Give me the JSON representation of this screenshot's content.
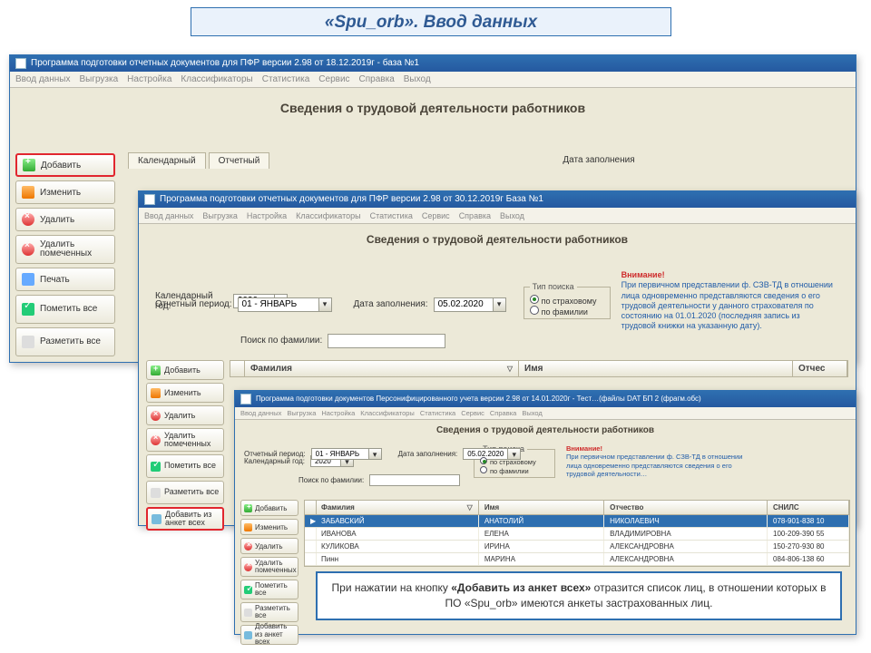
{
  "slide_title": "«Spu_orb». Ввод данных",
  "win1": {
    "title": "Программа подготовки отчетных документов для ПФР версии 2.98 от 18.12.2019г - база №1",
    "menu": [
      "Ввод данных",
      "Выгрузка",
      "Настройка",
      "Классификаторы",
      "Статистика",
      "Сервис",
      "Справка",
      "Выход"
    ],
    "heading": "Сведения о трудовой деятельности работников",
    "sidebar": [
      "Добавить",
      "Изменить",
      "Удалить",
      "Удалить помеченных",
      "Печать",
      "Пометить все",
      "Разметить все"
    ],
    "tabs": [
      "Календарный",
      "Отчетный"
    ],
    "date_label": "Дата заполнения"
  },
  "win2": {
    "title": "Программа подготовки отчетных документов для ПФР версии 2.98 от 30.12.2019г   База №1",
    "menu": [
      "Ввод данных",
      "Выгрузка",
      "Настройка",
      "Классификаторы",
      "Статистика",
      "Сервис",
      "Справка",
      "Выход"
    ],
    "heading": "Сведения о трудовой деятельности работников",
    "year_label": "Календарный год:",
    "year_value": "2020",
    "period_label": "Отчетный период:",
    "period_value": "01 - ЯНВАРЬ",
    "fill_date_label": "Дата заполнения:",
    "fill_date_value": "05.02.2020",
    "search_group": "Тип поиска",
    "radio1": "по страховому",
    "radio2": "по фамилии",
    "notice_title": "Внимание!",
    "notice_body": "При первичном представлении ф. СЗВ-ТД в отношении лица одновременно представляются сведения о его трудовой деятельности у данного страхователя по состоянию на 01.01.2020 (последняя запись из трудовой книжки на указанную дату).",
    "search_label": "Поиск по фамилии:",
    "columns": [
      "Фамилия",
      "Имя",
      "Отчес"
    ],
    "sidebar": [
      "Добавить",
      "Изменить",
      "Удалить",
      "Удалить помеченных",
      "Пометить все",
      "Разметить все",
      "Добавить из анкет всех"
    ]
  },
  "win3": {
    "title": "Программа подготовки документов Персонифицированного учета версии 2.98 от 14.01.2020г - Тест…(файлы DAT БП 2 (фрагм.обс)",
    "menu": [
      "Ввод данных",
      "Выгрузка",
      "Настройка",
      "Классификаторы",
      "Статистика",
      "Сервис",
      "Справка",
      "Выход"
    ],
    "heading": "Сведения о трудовой деятельности работников",
    "year_label": "Календарный год:",
    "year_value": "2020",
    "period_label": "Отчетный период:",
    "period_value": "01 - ЯНВАРЬ",
    "fill_date_label": "Дата заполнения:",
    "fill_date_value": "05.02.2020",
    "search_group": "Тип поиска",
    "radio1": "по страховому",
    "radio2": "по фамилии",
    "search_label": "Поиск по фамилии:",
    "notice_title": "Внимание!",
    "notice_body": "При первичном представлении ф. СЗВ-ТД в отношении лица одновременно представляются сведения о его трудовой деятельности…",
    "columns": [
      "Фамилия",
      "Имя",
      "Отчество",
      "СНИЛС"
    ],
    "sidebar": [
      "Добавить",
      "Изменить",
      "Удалить",
      "Удалить помеченных",
      "Пометить все",
      "Разметить все",
      "Добавить из анкет всех"
    ],
    "rows": [
      {
        "f": "ЗАБАВСКИЙ",
        "i": "АНАТОЛИЙ",
        "o": "НИКОЛАЕВИЧ",
        "s": "078-901-838 10"
      },
      {
        "f": "ИВАНОВА",
        "i": "ЕЛЕНА",
        "o": "ВЛАДИМИРОВНА",
        "s": "100-209-390 55"
      },
      {
        "f": "КУЛИКОВА",
        "i": "ИРИНА",
        "o": "АЛЕКСАНДРОВНА",
        "s": "150-270-930 80"
      },
      {
        "f": "Пинн",
        "i": "МАРИНА",
        "o": "АЛЕКСАНДРОВНА",
        "s": "084-806-138 60"
      }
    ]
  },
  "callout": "При нажатии на кнопку «Добавить из анкет всех» отразится список лиц, в отношении которых в ПО «Spu_orb» имеются анкеты застрахованных лиц.",
  "chart_data": {
    "type": "table"
  }
}
